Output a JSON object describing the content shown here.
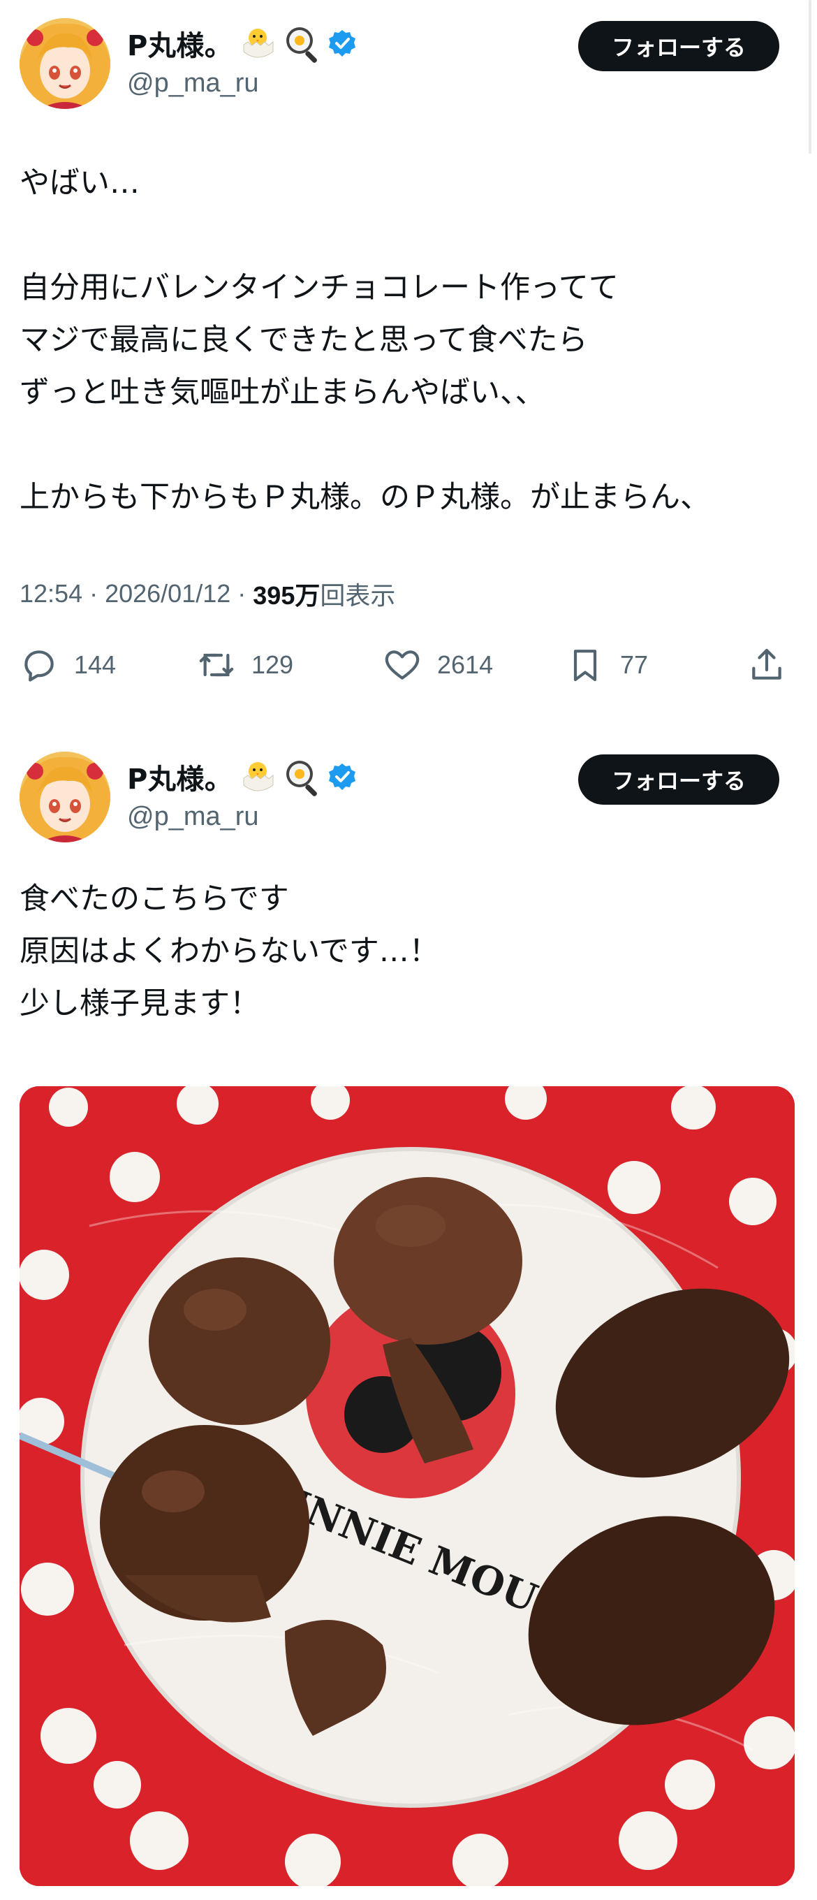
{
  "tweets": [
    {
      "author": {
        "display_name": "P丸様。",
        "handle": "@p_ma_ru",
        "name_emojis": [
          "hatching-chick-icon",
          "fried-egg-pan-icon"
        ],
        "verified": true
      },
      "follow_label": "フォローする",
      "text_lines": [
        "やばい…",
        "",
        "自分用にバレンタインチョコレート作ってて",
        "マジで最高に良くできたと思って食べたら",
        "ずっと吐き気嘔吐が止まらんやばい、、",
        "",
        "上からも下からもＰ丸様。のＰ丸様。が止まらん、"
      ],
      "time": "12:54",
      "date": "2026/01/12",
      "views_count": "395万",
      "views_label": "回表示",
      "actions": {
        "replies": "144",
        "retweets": "129",
        "likes": "2614",
        "bookmarks": "77"
      }
    },
    {
      "author": {
        "display_name": "P丸様。",
        "handle": "@p_ma_ru",
        "name_emojis": [
          "hatching-chick-icon",
          "fried-egg-pan-icon"
        ],
        "verified": true
      },
      "follow_label": "フォローする",
      "text_lines": [
        "食べたのこちらです",
        "原因はよくわからないです…！",
        "少し様子見ます！"
      ],
      "media": {
        "plate_text": "MINNIE MOUSE"
      }
    }
  ],
  "colors": {
    "text_primary": "#0f1419",
    "text_secondary": "#536471",
    "verified_blue": "#1d9bf0",
    "follow_button_bg": "#0f1419",
    "plate_red": "#d9222a",
    "chocolate": "#4a2818"
  }
}
